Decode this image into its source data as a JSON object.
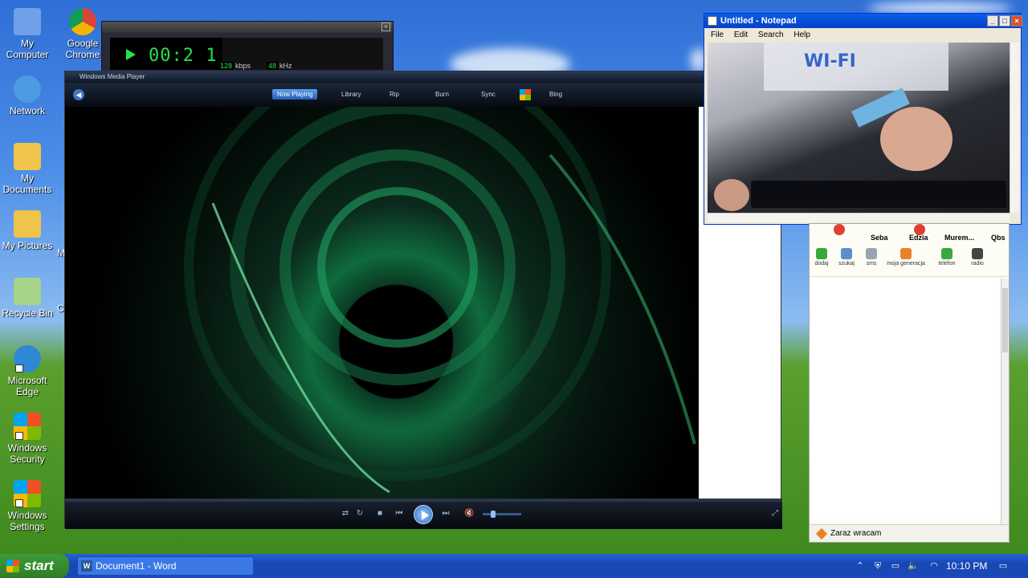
{
  "desktop": {
    "icons": [
      {
        "label": "My Computer",
        "color": "#6fa0e8"
      },
      {
        "label": "Google Chrome",
        "color": "#e8a33a"
      },
      {
        "label": "Network",
        "color": "#4d9be0"
      },
      {
        "label": "My Documents",
        "color": "#f0c34a"
      },
      {
        "label": "My Pictures",
        "color": "#f0c34a"
      },
      {
        "label": "Recycle Bin",
        "color": "#a6d38a"
      },
      {
        "label": "Microsoft Edge",
        "color": "#2f88d6"
      },
      {
        "label": "Windows Security",
        "color": "#58b84a"
      },
      {
        "label": "Windows Settings",
        "color": "#4bb0e3"
      }
    ],
    "partial_labels": [
      "M",
      "C"
    ]
  },
  "winamp": {
    "time": "00:2 1",
    "kbps_value": "128",
    "kbps_label": "kbps",
    "khz_value": "48",
    "khz_label": "kHz"
  },
  "wmp": {
    "title": "Windows Media Player",
    "nav": [
      "Now Playing",
      "Library",
      "Rip",
      "Burn",
      "Sync",
      "Bing"
    ],
    "active_tab": "Now Playing"
  },
  "notepad": {
    "title": "Untitled - Notepad",
    "menu": [
      "File",
      "Edit",
      "Search",
      "Help"
    ]
  },
  "messenger": {
    "contacts": [
      "Seba",
      "Edzia",
      "Murem...",
      "Qbs"
    ],
    "tools": [
      "dodaj",
      "szukaj",
      "sms",
      "moja generacja",
      "telefon",
      "radio"
    ],
    "status": "Zaraz wracam"
  },
  "taskbar": {
    "start": "start",
    "task": "Document1 - Word",
    "clock": "10:10 PM"
  },
  "colors": {
    "xp_blue": "#2461d6",
    "start_green": "#3d9b38",
    "wmp_dark": "#070b12",
    "visualizer_green": "#0f6b3c"
  }
}
